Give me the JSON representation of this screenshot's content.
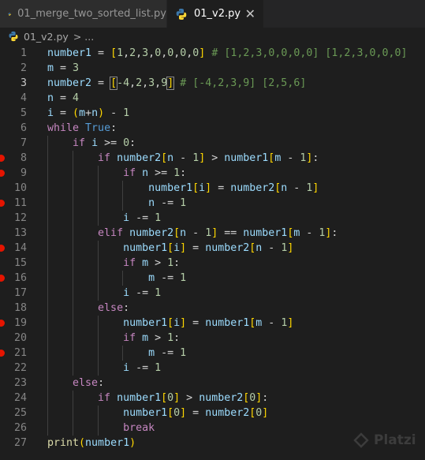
{
  "tabs": [
    {
      "label": "01_merge_two_sorted_list.py",
      "active": false
    },
    {
      "label": "01_v2.py",
      "active": true,
      "close": "✕"
    }
  ],
  "breadcrumb": {
    "file": "01_v2.py",
    "separator": ">",
    "rest": "..."
  },
  "watermark": "Platzi",
  "breakpoint_lines": [
    8,
    9,
    11,
    14,
    16,
    19,
    21
  ],
  "current_line": 3,
  "lines": [
    {
      "n": "1",
      "t": [
        [
          "number1",
          "v"
        ],
        [
          " = ",
          "o"
        ],
        [
          "[",
          "br1"
        ],
        [
          "1",
          "n"
        ],
        [
          ",",
          "o"
        ],
        [
          "2",
          "n"
        ],
        [
          ",",
          "o"
        ],
        [
          "3",
          "n"
        ],
        [
          ",",
          "o"
        ],
        [
          "0",
          "n"
        ],
        [
          ",",
          "o"
        ],
        [
          "0",
          "n"
        ],
        [
          ",",
          "o"
        ],
        [
          "0",
          "n"
        ],
        [
          ",",
          "o"
        ],
        [
          "0",
          "n"
        ],
        [
          "]",
          "br1"
        ],
        [
          " # [1,2,3,0,0,0,0] [1,2,3,0,0,0]",
          "c"
        ]
      ]
    },
    {
      "n": "2",
      "t": [
        [
          "m",
          "v"
        ],
        [
          " = ",
          "o"
        ],
        [
          "3",
          "n"
        ]
      ]
    },
    {
      "n": "3",
      "t": [
        [
          "number2",
          "v"
        ],
        [
          " = ",
          "o"
        ],
        [
          "[",
          "br1 hl"
        ],
        [
          "-4",
          "n"
        ],
        [
          ",",
          "o"
        ],
        [
          "2",
          "n"
        ],
        [
          ",",
          "o"
        ],
        [
          "3",
          "n"
        ],
        [
          ",",
          "o"
        ],
        [
          "9",
          "n"
        ],
        [
          "]",
          "br1 hl"
        ],
        [
          " # [-4,2,3,9] [2,5,6]",
          "c"
        ]
      ]
    },
    {
      "n": "4",
      "t": [
        [
          "n",
          "v"
        ],
        [
          " = ",
          "o"
        ],
        [
          "4",
          "n"
        ]
      ]
    },
    {
      "n": "5",
      "t": [
        [
          "i",
          "v"
        ],
        [
          " = ",
          "o"
        ],
        [
          "(",
          "br1"
        ],
        [
          "m",
          "v"
        ],
        [
          "+",
          "o"
        ],
        [
          "n",
          "v"
        ],
        [
          ")",
          "br1"
        ],
        [
          " - ",
          "o"
        ],
        [
          "1",
          "n"
        ]
      ]
    },
    {
      "n": "6",
      "t": [
        [
          "while",
          "k"
        ],
        [
          " ",
          "o"
        ],
        [
          "True",
          "b"
        ],
        [
          ":",
          "o"
        ]
      ]
    },
    {
      "n": "7",
      "t": [
        [
          "    ",
          "o"
        ],
        [
          "if",
          "k"
        ],
        [
          " ",
          "o"
        ],
        [
          "i",
          "v"
        ],
        [
          " >= ",
          "o"
        ],
        [
          "0",
          "n"
        ],
        [
          ":",
          "o"
        ]
      ]
    },
    {
      "n": "8",
      "t": [
        [
          "        ",
          "o"
        ],
        [
          "if",
          "k"
        ],
        [
          " ",
          "o"
        ],
        [
          "number2",
          "v"
        ],
        [
          "[",
          "br1"
        ],
        [
          "n",
          "v"
        ],
        [
          " - ",
          "o"
        ],
        [
          "1",
          "n"
        ],
        [
          "]",
          "br1"
        ],
        [
          " > ",
          "o"
        ],
        [
          "number1",
          "v"
        ],
        [
          "[",
          "br1"
        ],
        [
          "m",
          "v"
        ],
        [
          " - ",
          "o"
        ],
        [
          "1",
          "n"
        ],
        [
          "]",
          "br1"
        ],
        [
          ":",
          "o"
        ]
      ]
    },
    {
      "n": "9",
      "t": [
        [
          "            ",
          "o"
        ],
        [
          "if",
          "k"
        ],
        [
          " ",
          "o"
        ],
        [
          "n",
          "v"
        ],
        [
          " >= ",
          "o"
        ],
        [
          "1",
          "n"
        ],
        [
          ":",
          "o"
        ]
      ]
    },
    {
      "n": "10",
      "t": [
        [
          "                ",
          "o"
        ],
        [
          "number1",
          "v"
        ],
        [
          "[",
          "br1"
        ],
        [
          "i",
          "v"
        ],
        [
          "]",
          "br1"
        ],
        [
          " = ",
          "o"
        ],
        [
          "number2",
          "v"
        ],
        [
          "[",
          "br1"
        ],
        [
          "n",
          "v"
        ],
        [
          " - ",
          "o"
        ],
        [
          "1",
          "n"
        ],
        [
          "]",
          "br1"
        ]
      ]
    },
    {
      "n": "11",
      "t": [
        [
          "                ",
          "o"
        ],
        [
          "n",
          "v"
        ],
        [
          " -= ",
          "o"
        ],
        [
          "1",
          "n"
        ]
      ]
    },
    {
      "n": "12",
      "t": [
        [
          "            ",
          "o"
        ],
        [
          "i",
          "v"
        ],
        [
          " -= ",
          "o"
        ],
        [
          "1",
          "n"
        ]
      ]
    },
    {
      "n": "13",
      "t": [
        [
          "        ",
          "o"
        ],
        [
          "elif",
          "k"
        ],
        [
          " ",
          "o"
        ],
        [
          "number2",
          "v"
        ],
        [
          "[",
          "br1"
        ],
        [
          "n",
          "v"
        ],
        [
          " - ",
          "o"
        ],
        [
          "1",
          "n"
        ],
        [
          "]",
          "br1"
        ],
        [
          " == ",
          "o"
        ],
        [
          "number1",
          "v"
        ],
        [
          "[",
          "br1"
        ],
        [
          "m",
          "v"
        ],
        [
          " - ",
          "o"
        ],
        [
          "1",
          "n"
        ],
        [
          "]",
          "br1"
        ],
        [
          ":",
          "o"
        ]
      ]
    },
    {
      "n": "14",
      "t": [
        [
          "            ",
          "o"
        ],
        [
          "number1",
          "v"
        ],
        [
          "[",
          "br1"
        ],
        [
          "i",
          "v"
        ],
        [
          "]",
          "br1"
        ],
        [
          " = ",
          "o"
        ],
        [
          "number2",
          "v"
        ],
        [
          "[",
          "br1"
        ],
        [
          "n",
          "v"
        ],
        [
          " - ",
          "o"
        ],
        [
          "1",
          "n"
        ],
        [
          "]",
          "br1"
        ]
      ]
    },
    {
      "n": "15",
      "t": [
        [
          "            ",
          "o"
        ],
        [
          "if",
          "k"
        ],
        [
          " ",
          "o"
        ],
        [
          "m",
          "v"
        ],
        [
          " > ",
          "o"
        ],
        [
          "1",
          "n"
        ],
        [
          ":",
          "o"
        ]
      ]
    },
    {
      "n": "16",
      "t": [
        [
          "                ",
          "o"
        ],
        [
          "m",
          "v"
        ],
        [
          " -= ",
          "o"
        ],
        [
          "1",
          "n"
        ]
      ]
    },
    {
      "n": "17",
      "t": [
        [
          "            ",
          "o"
        ],
        [
          "i",
          "v"
        ],
        [
          " -= ",
          "o"
        ],
        [
          "1",
          "n"
        ]
      ]
    },
    {
      "n": "18",
      "t": [
        [
          "        ",
          "o"
        ],
        [
          "else",
          "k"
        ],
        [
          ":",
          "o"
        ]
      ]
    },
    {
      "n": "19",
      "t": [
        [
          "            ",
          "o"
        ],
        [
          "number1",
          "v"
        ],
        [
          "[",
          "br1"
        ],
        [
          "i",
          "v"
        ],
        [
          "]",
          "br1"
        ],
        [
          " = ",
          "o"
        ],
        [
          "number1",
          "v"
        ],
        [
          "[",
          "br1"
        ],
        [
          "m",
          "v"
        ],
        [
          " - ",
          "o"
        ],
        [
          "1",
          "n"
        ],
        [
          "]",
          "br1"
        ]
      ]
    },
    {
      "n": "20",
      "t": [
        [
          "            ",
          "o"
        ],
        [
          "if",
          "k"
        ],
        [
          " ",
          "o"
        ],
        [
          "m",
          "v"
        ],
        [
          " > ",
          "o"
        ],
        [
          "1",
          "n"
        ],
        [
          ":",
          "o"
        ]
      ]
    },
    {
      "n": "21",
      "t": [
        [
          "                ",
          "o"
        ],
        [
          "m",
          "v"
        ],
        [
          " -= ",
          "o"
        ],
        [
          "1",
          "n"
        ]
      ]
    },
    {
      "n": "22",
      "t": [
        [
          "            ",
          "o"
        ],
        [
          "i",
          "v"
        ],
        [
          " -= ",
          "o"
        ],
        [
          "1",
          "n"
        ]
      ]
    },
    {
      "n": "23",
      "t": [
        [
          "    ",
          "o"
        ],
        [
          "else",
          "k"
        ],
        [
          ":",
          "o"
        ]
      ]
    },
    {
      "n": "24",
      "t": [
        [
          "        ",
          "o"
        ],
        [
          "if",
          "k"
        ],
        [
          " ",
          "o"
        ],
        [
          "number1",
          "v"
        ],
        [
          "[",
          "br1"
        ],
        [
          "0",
          "n"
        ],
        [
          "]",
          "br1"
        ],
        [
          " > ",
          "o"
        ],
        [
          "number2",
          "v"
        ],
        [
          "[",
          "br1"
        ],
        [
          "0",
          "n"
        ],
        [
          "]",
          "br1"
        ],
        [
          ":",
          "o"
        ]
      ]
    },
    {
      "n": "25",
      "t": [
        [
          "            ",
          "o"
        ],
        [
          "number1",
          "v"
        ],
        [
          "[",
          "br1"
        ],
        [
          "0",
          "n"
        ],
        [
          "]",
          "br1"
        ],
        [
          " = ",
          "o"
        ],
        [
          "number2",
          "v"
        ],
        [
          "[",
          "br1"
        ],
        [
          "0",
          "n"
        ],
        [
          "]",
          "br1"
        ]
      ]
    },
    {
      "n": "26",
      "t": [
        [
          "            ",
          "o"
        ],
        [
          "break",
          "k"
        ]
      ]
    },
    {
      "n": "27",
      "t": [
        [
          "print",
          "f"
        ],
        [
          "(",
          "br1"
        ],
        [
          "number1",
          "v"
        ],
        [
          ")",
          "br1"
        ]
      ]
    }
  ]
}
